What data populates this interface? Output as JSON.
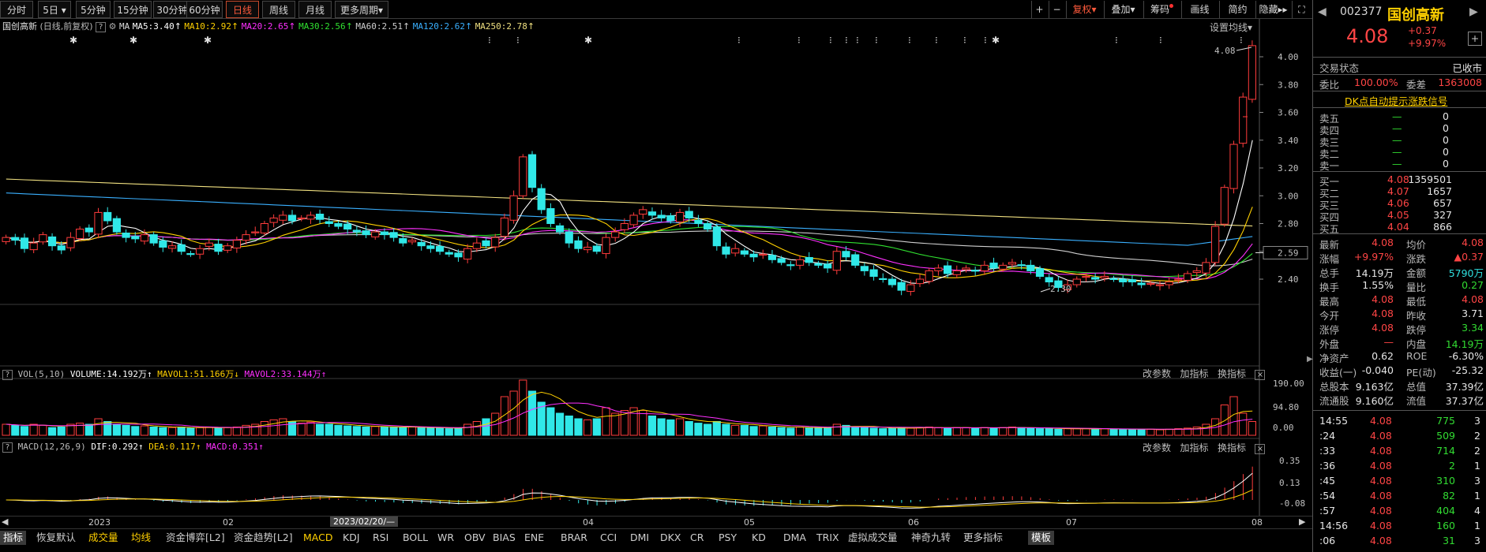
{
  "toolbar": {
    "periods": [
      "分时",
      "5日",
      "5分钟",
      "15分钟",
      "30分钟",
      "60分钟",
      "日线",
      "周线",
      "月线",
      "更多周期"
    ],
    "right_buttons": [
      "+",
      "−",
      "复权",
      "叠加",
      "筹码",
      "画线",
      "简约",
      "隐藏"
    ]
  },
  "main_legend": {
    "name": "国创高新",
    "mode": "(日线,前复权)",
    "ma_label": "MA",
    "ma5": "MA5:3.40",
    "ma10": "MA10:2.92",
    "ma20": "MA20:2.65",
    "ma30": "MA30:2.56",
    "ma60": "MA60:2.51",
    "ma120": "MA120:2.62",
    "ma250": "MA250:2.78",
    "settings": "设置均线"
  },
  "vol_legend": {
    "name": "VOL(5,10)",
    "volume": "VOLUME:14.192万",
    "mavol1": "MAVOL1:51.166万",
    "mavol2": "MAVOL2:33.144万"
  },
  "macd_legend": {
    "name": "MACD(12,26,9)",
    "dif": "DIF:0.292",
    "dea": "DEA:0.117",
    "macd": "MACD:0.351"
  },
  "panel_tools": [
    "改参数",
    "加指标",
    "换指标"
  ],
  "chart_data": {
    "type": "candlestick",
    "price_axis": [
      "4.00",
      "3.80",
      "3.60",
      "3.40",
      "3.20",
      "3.00",
      "2.80",
      "2.60",
      "2.40"
    ],
    "current_price_label": "2.59",
    "high_label": "4.08",
    "low_label": "2.30",
    "vol_axis": [
      "190.00",
      "94.80",
      "0.00"
    ],
    "macd_axis": [
      "0.35",
      "0.13",
      "-0.08"
    ],
    "x_labels": [
      "2023",
      "02",
      "04",
      "05",
      "06",
      "07",
      "08"
    ],
    "cursor_date": "2023/02/20/—",
    "closes": [
      2.7,
      2.68,
      2.62,
      2.66,
      2.72,
      2.64,
      2.61,
      2.7,
      2.76,
      2.74,
      2.88,
      2.82,
      2.74,
      2.7,
      2.69,
      2.72,
      2.66,
      2.63,
      2.64,
      2.6,
      2.58,
      2.62,
      2.66,
      2.6,
      2.64,
      2.68,
      2.72,
      2.74,
      2.8,
      2.84,
      2.86,
      2.82,
      2.84,
      2.86,
      2.83,
      2.8,
      2.78,
      2.76,
      2.74,
      2.72,
      2.74,
      2.72,
      2.7,
      2.66,
      2.68,
      2.64,
      2.62,
      2.6,
      2.58,
      2.56,
      2.62,
      2.66,
      2.64,
      2.7,
      2.84,
      3.0,
      3.28,
      3.06,
      2.9,
      2.8,
      2.74,
      2.66,
      2.62,
      2.63,
      2.6,
      2.7,
      2.74,
      2.8,
      2.86,
      2.9,
      2.86,
      2.84,
      2.82,
      2.88,
      2.84,
      2.8,
      2.76,
      2.64,
      2.58,
      2.62,
      2.58,
      2.56,
      2.58,
      2.54,
      2.52,
      2.5,
      2.54,
      2.52,
      2.5,
      2.48,
      2.6,
      2.56,
      2.5,
      2.46,
      2.42,
      2.4,
      2.36,
      2.32,
      2.36,
      2.4,
      2.46,
      2.48,
      2.44,
      2.46,
      2.48,
      2.46,
      2.5,
      2.48,
      2.5,
      2.52,
      2.5,
      2.46,
      2.42,
      2.38,
      2.34,
      2.36,
      2.4,
      2.42,
      2.4,
      2.42,
      2.4,
      2.38,
      2.38,
      2.36,
      2.37,
      2.36,
      2.38,
      2.4,
      2.44,
      2.46,
      2.52,
      2.78,
      3.06,
      3.37,
      3.71,
      4.08
    ],
    "vol_levels": [
      0.2,
      0.18,
      0.16,
      0.2,
      0.18,
      0.14,
      0.15,
      0.2,
      0.22,
      0.2,
      0.3,
      0.25,
      0.2,
      0.18,
      0.16,
      0.17,
      0.15,
      0.14,
      0.14,
      0.15,
      0.13,
      0.14,
      0.15,
      0.13,
      0.14,
      0.15,
      0.18,
      0.2,
      0.25,
      0.28,
      0.3,
      0.25,
      0.22,
      0.24,
      0.2,
      0.2,
      0.18,
      0.17,
      0.16,
      0.15,
      0.16,
      0.15,
      0.15,
      0.14,
      0.15,
      0.14,
      0.13,
      0.13,
      0.12,
      0.13,
      0.2,
      0.25,
      0.3,
      0.4,
      0.7,
      0.8,
      1.0,
      0.8,
      0.6,
      0.5,
      0.4,
      0.35,
      0.3,
      0.28,
      0.3,
      0.5,
      0.4,
      0.45,
      0.5,
      0.45,
      0.35,
      0.3,
      0.28,
      0.3,
      0.25,
      0.22,
      0.2,
      0.25,
      0.2,
      0.18,
      0.18,
      0.16,
      0.17,
      0.15,
      0.14,
      0.13,
      0.15,
      0.14,
      0.14,
      0.13,
      0.2,
      0.18,
      0.15,
      0.14,
      0.13,
      0.12,
      0.13,
      0.14,
      0.13,
      0.14,
      0.15,
      0.14,
      0.13,
      0.14,
      0.14,
      0.13,
      0.14,
      0.13,
      0.14,
      0.15,
      0.14,
      0.13,
      0.12,
      0.12,
      0.11,
      0.12,
      0.12,
      0.12,
      0.11,
      0.12,
      0.11,
      0.11,
      0.11,
      0.1,
      0.11,
      0.1,
      0.11,
      0.12,
      0.13,
      0.15,
      0.2,
      0.3,
      0.55,
      0.7,
      0.4,
      0.25
    ]
  },
  "bottom_tabs": [
    "指标",
    "恢复默认",
    "成交量",
    "均线",
    "资金博弈[L2]",
    "资金趋势[L2]",
    "MACD",
    "KDJ",
    "RSI",
    "BOLL",
    "WR",
    "OBV",
    "BIAS",
    "ENE",
    "BRAR",
    "CCI",
    "DMI",
    "DKX",
    "CR",
    "PSY",
    "KD",
    "DMA",
    "TRIX",
    "虚拟成交量",
    "神奇九转",
    "更多指标",
    "模板"
  ],
  "quote": {
    "code": "002377",
    "name": "国创高新",
    "price": "4.08",
    "change": "+0.37",
    "change_pct": "+9.97%",
    "status_label": "交易状态",
    "status": "已收市",
    "wb_label": "委比",
    "wb": "100.00%",
    "wc_label": "委差",
    "wc": "1363008",
    "dk_link": "DK点自动提示涨跌信号",
    "asks": [
      {
        "l": "卖五",
        "p": "—",
        "v": "0"
      },
      {
        "l": "卖四",
        "p": "—",
        "v": "0"
      },
      {
        "l": "卖三",
        "p": "—",
        "v": "0"
      },
      {
        "l": "卖二",
        "p": "—",
        "v": "0"
      },
      {
        "l": "卖一",
        "p": "—",
        "v": "0"
      }
    ],
    "bids": [
      {
        "l": "买一",
        "p": "4.08",
        "v": "1359501"
      },
      {
        "l": "买二",
        "p": "4.07",
        "v": "1657"
      },
      {
        "l": "买三",
        "p": "4.06",
        "v": "657"
      },
      {
        "l": "买四",
        "p": "4.05",
        "v": "327"
      },
      {
        "l": "买五",
        "p": "4.04",
        "v": "866"
      }
    ],
    "stats": [
      {
        "a": "最新",
        "av": "4.08",
        "ac": "red",
        "b": "均价",
        "bv": "4.08",
        "bc": "red"
      },
      {
        "a": "涨幅",
        "av": "+9.97%",
        "ac": "red",
        "b": "涨跌",
        "bv": "▲0.37",
        "bc": "red"
      },
      {
        "a": "总手",
        "av": "14.19万",
        "ac": "wh",
        "b": "金额",
        "bv": "5790万",
        "bc": "cy"
      },
      {
        "a": "换手",
        "av": "1.55%",
        "ac": "wh",
        "b": "量比",
        "bv": "0.27",
        "bc": "green"
      },
      {
        "a": "最高",
        "av": "4.08",
        "ac": "red",
        "b": "最低",
        "bv": "4.08",
        "bc": "red"
      },
      {
        "a": "今开",
        "av": "4.08",
        "ac": "red",
        "b": "昨收",
        "bv": "3.71",
        "bc": "wh"
      },
      {
        "a": "涨停",
        "av": "4.08",
        "ac": "red",
        "b": "跌停",
        "bv": "3.34",
        "bc": "green"
      },
      {
        "a": "外盘",
        "av": "—",
        "ac": "red",
        "b": "内盘",
        "bv": "14.19万",
        "bc": "green"
      },
      {
        "a": "净资产",
        "av": "0.62",
        "ac": "wh",
        "b": "ROE",
        "bv": "-6.30%",
        "bc": "wh"
      },
      {
        "a": "收益(一)",
        "av": "-0.040",
        "ac": "wh",
        "b": "PE(动)",
        "bv": "-25.32",
        "bc": "wh"
      },
      {
        "a": "总股本",
        "av": "9.163亿",
        "ac": "wh",
        "b": "总值",
        "bv": "37.39亿",
        "bc": "wh"
      },
      {
        "a": "流通股",
        "av": "9.160亿",
        "ac": "wh",
        "b": "流值",
        "bv": "37.37亿",
        "bc": "wh"
      }
    ],
    "ticks": [
      {
        "t": "14:55",
        "p": "4.08",
        "v": "775",
        "n": "3"
      },
      {
        "t": ":24",
        "p": "4.08",
        "v": "509",
        "n": "2"
      },
      {
        "t": ":33",
        "p": "4.08",
        "v": "714",
        "n": "2"
      },
      {
        "t": ":36",
        "p": "4.08",
        "v": "2",
        "n": "1"
      },
      {
        "t": ":45",
        "p": "4.08",
        "v": "310",
        "n": "3"
      },
      {
        "t": ":54",
        "p": "4.08",
        "v": "82",
        "n": "1"
      },
      {
        "t": ":57",
        "p": "4.08",
        "v": "404",
        "n": "4"
      },
      {
        "t": "14:56",
        "p": "4.08",
        "v": "160",
        "n": "1"
      },
      {
        "t": ":06",
        "p": "4.08",
        "v": "31",
        "n": "3"
      }
    ]
  }
}
